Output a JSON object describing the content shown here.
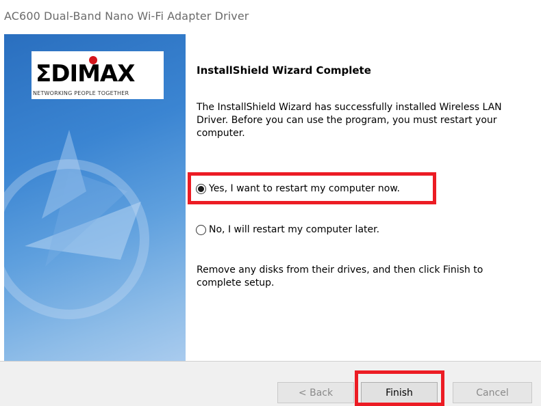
{
  "window": {
    "title": "AC600 Dual-Band Nano Wi-Fi Adapter Driver"
  },
  "logo": {
    "word": "ΣDIMAX",
    "tagline": "NETWORKING PEOPLE TOGETHER"
  },
  "wizard": {
    "heading": "InstallShield Wizard Complete",
    "message": "The InstallShield Wizard has successfully installed Wireless LAN Driver.  Before you can use the program, you must restart your computer.",
    "options": [
      {
        "label": "Yes, I want to restart my computer now.",
        "selected": true
      },
      {
        "label": "No, I will restart my computer later.",
        "selected": false
      }
    ],
    "finish_note": "Remove any disks from their drives, and then click Finish to complete setup."
  },
  "buttons": {
    "back": "< Back",
    "finish": "Finish",
    "cancel": "Cancel"
  },
  "colors": {
    "highlight": "#ec1c24",
    "banner": "#3b85d2"
  }
}
